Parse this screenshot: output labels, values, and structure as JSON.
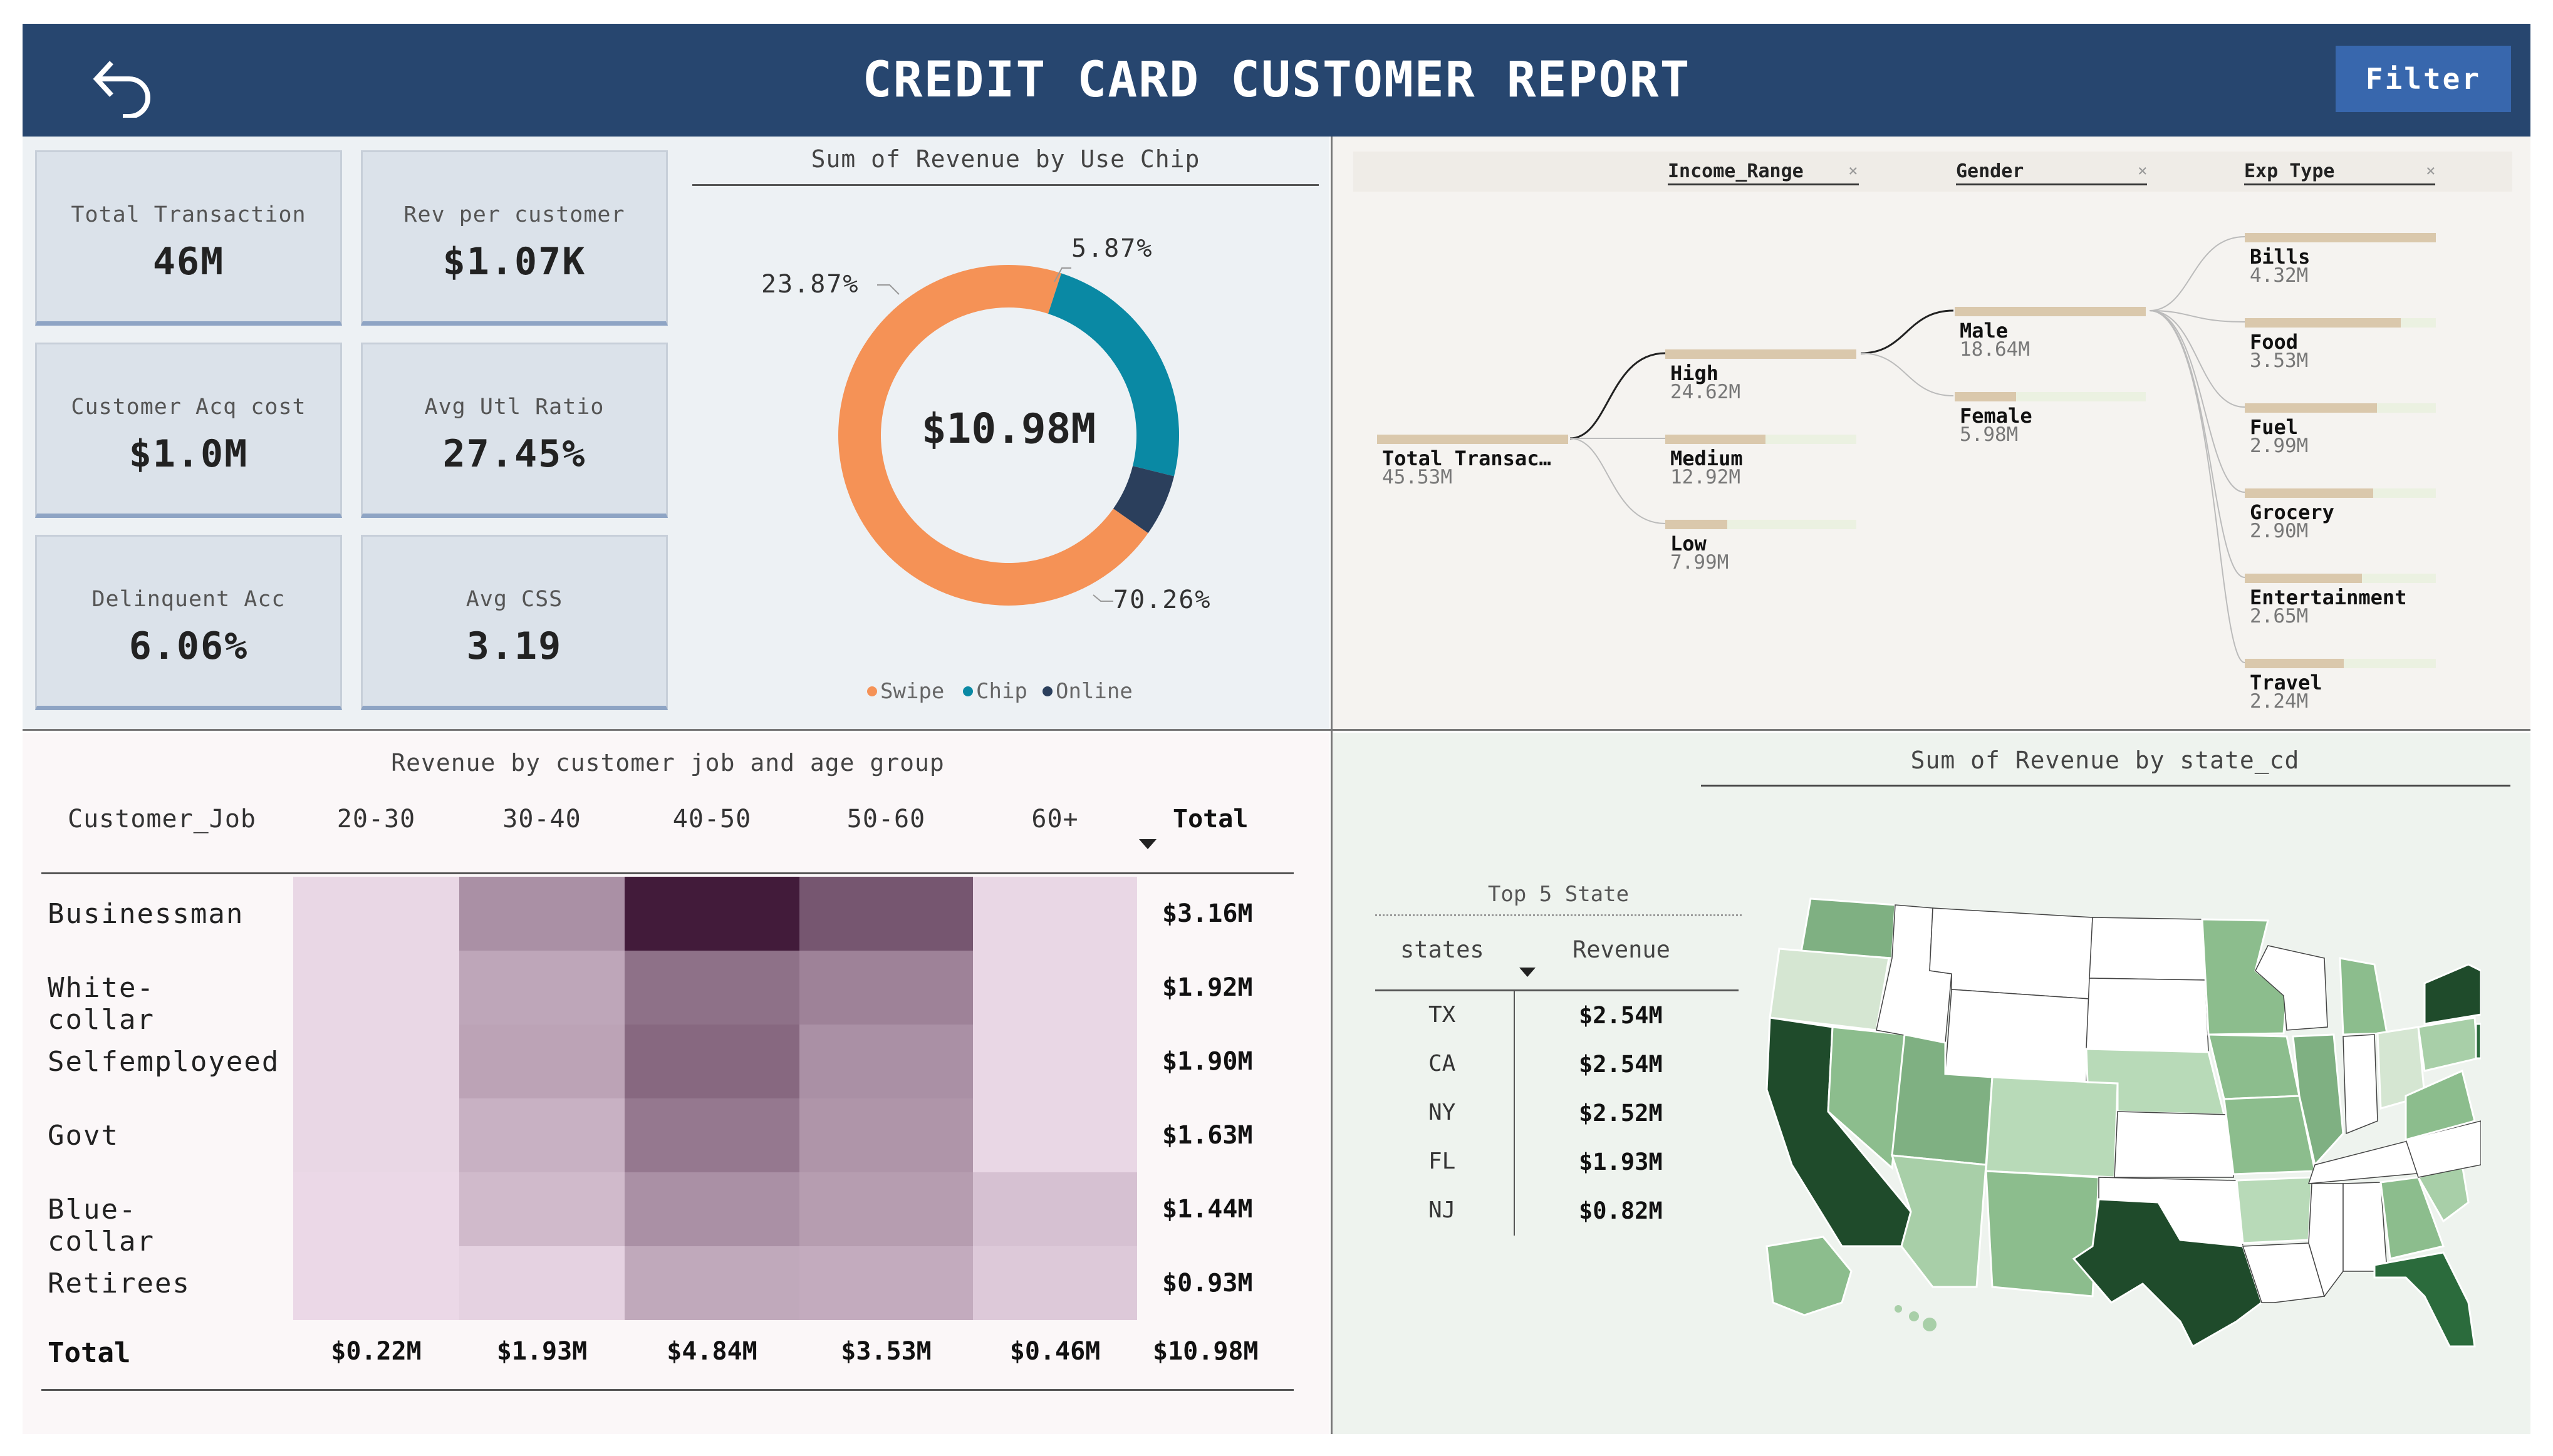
{
  "header": {
    "title": "CREDIT CARD CUSTOMER REPORT",
    "filter_label": "Filter"
  },
  "kpis": [
    {
      "label": "Total Transaction",
      "value": "46M"
    },
    {
      "label": "Rev per customer",
      "value": "$1.07K"
    },
    {
      "label": "Customer Acq cost",
      "value": "$1.0M"
    },
    {
      "label": "Avg Utl Ratio",
      "value": "27.45%"
    },
    {
      "label": "Delinquent Acc",
      "value": "6.06%"
    },
    {
      "label": "Avg CSS",
      "value": "3.19"
    }
  ],
  "colors": {
    "header": "#27466f",
    "swipe": "#f59256",
    "chip": "#0a89a4",
    "online": "#2b3f5c",
    "tree_bar": "#dac8ac",
    "tree_track": "#ebf1e1"
  },
  "donut": {
    "title": "Sum of Revenue by Use Chip",
    "center_label": "$10.98M",
    "slice_labels": {
      "swipe": "70.26%",
      "chip": "23.87%",
      "online": "5.87%"
    },
    "legend": [
      "Swipe",
      "Chip",
      "Online"
    ]
  },
  "tree": {
    "headers": [
      "Income_Range",
      "Gender",
      "Exp Type"
    ],
    "root": {
      "label": "Total Transac…",
      "value": "45.53M"
    },
    "income": [
      {
        "label": "High",
        "value": "24.62M"
      },
      {
        "label": "Medium",
        "value": "12.92M"
      },
      {
        "label": "Low",
        "value": "7.99M"
      }
    ],
    "gender": [
      {
        "label": "Male",
        "value": "18.64M"
      },
      {
        "label": "Female",
        "value": "5.98M"
      }
    ],
    "exp": [
      {
        "label": "Bills",
        "value": "4.32M"
      },
      {
        "label": "Food",
        "value": "3.53M"
      },
      {
        "label": "Fuel",
        "value": "2.99M"
      },
      {
        "label": "Grocery",
        "value": "2.90M"
      },
      {
        "label": "Entertainment",
        "value": "2.65M"
      },
      {
        "label": "Travel",
        "value": "2.24M"
      }
    ]
  },
  "matrix": {
    "title": "Revenue by customer job and age group",
    "row_header": "Customer_Job",
    "total_label": "Total"
  },
  "states": {
    "title": "Sum of Revenue by state_cd",
    "table_title": "Top 5 State",
    "col_state": "states",
    "col_revenue": "Revenue",
    "rows": [
      {
        "state": "TX",
        "revenue": "$2.54M"
      },
      {
        "state": "CA",
        "revenue": "$2.54M"
      },
      {
        "state": "NY",
        "revenue": "$2.52M"
      },
      {
        "state": "FL",
        "revenue": "$1.93M"
      },
      {
        "state": "NJ",
        "revenue": "$0.82M"
      }
    ]
  },
  "chart_data": [
    {
      "type": "pie",
      "title": "Sum of Revenue by Use Chip",
      "categories": [
        "Swipe",
        "Chip",
        "Online"
      ],
      "values": [
        70.26,
        23.87,
        5.87
      ],
      "center": "$10.98M",
      "legend": "bottom"
    },
    {
      "type": "heatmap",
      "title": "Revenue by customer job and age group",
      "x": [
        "20-30",
        "30-40",
        "40-50",
        "50-60",
        "60+"
      ],
      "y": [
        "Businessman",
        "White-collar",
        "Selfemployeed",
        "Govt",
        "Blue-collar",
        "Retirees"
      ],
      "row_totals": [
        "$3.16M",
        "$1.92M",
        "$1.90M",
        "$1.63M",
        "$1.44M",
        "$0.93M"
      ],
      "col_totals": [
        "$0.22M",
        "$1.93M",
        "$4.84M",
        "$3.53M",
        "$0.46M"
      ],
      "grand_total": "$10.98M",
      "values": [
        [
          0.04,
          0.55,
          1.52,
          1.02,
          0.04
        ],
        [
          0.04,
          0.38,
          0.8,
          0.66,
          0.04
        ],
        [
          0.04,
          0.4,
          0.87,
          0.55,
          0.04
        ],
        [
          0.04,
          0.3,
          0.74,
          0.51,
          0.04
        ],
        [
          0.03,
          0.23,
          0.55,
          0.45,
          0.18
        ],
        [
          0.03,
          0.07,
          0.36,
          0.34,
          0.13
        ]
      ]
    },
    {
      "type": "table",
      "title": "Top 5 State",
      "categories": [
        "TX",
        "CA",
        "NY",
        "FL",
        "NJ"
      ],
      "values": [
        2.54,
        2.54,
        2.52,
        1.93,
        0.82
      ],
      "unit": "$M"
    }
  ]
}
